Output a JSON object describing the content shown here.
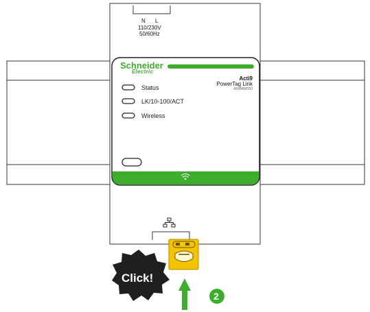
{
  "terminal": {
    "n_label": "N",
    "l_label": "L",
    "voltage": "110/230V",
    "frequency": "50/60Hz"
  },
  "brand": {
    "name": "Schneider",
    "sub": "Electric",
    "green": "#3dae2b"
  },
  "product": {
    "line1": "Acti9",
    "line2": "PowerTag Link",
    "line3": "A9XMWD20"
  },
  "indicators": [
    {
      "label": "Status"
    },
    {
      "label": "LK/10-100/ACT"
    },
    {
      "label": "Wireless"
    }
  ],
  "icons": {
    "wifi": "wifi-icon",
    "network": "network-icon",
    "arrow": "up-arrow-icon"
  },
  "callout": {
    "click_text": "Click!",
    "step_number": "2"
  },
  "colors": {
    "accent_green": "#3dae2b",
    "connector_yellow": "#f5c400",
    "burst": "#1f1f1f"
  }
}
